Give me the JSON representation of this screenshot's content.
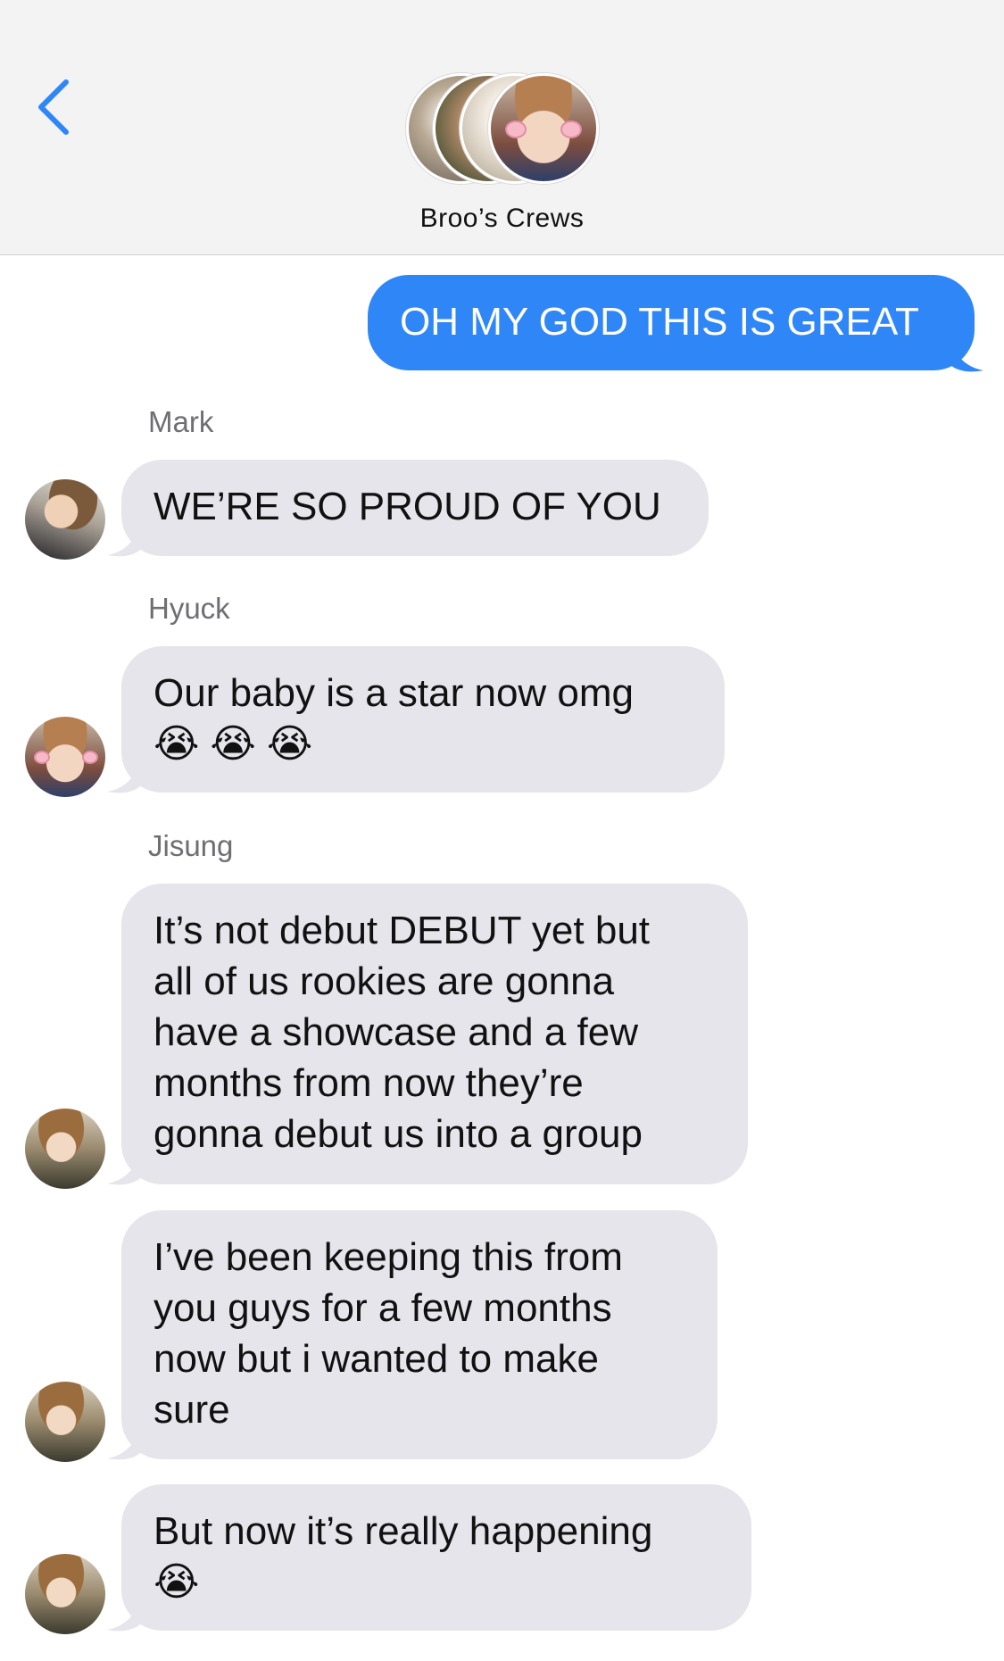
{
  "header": {
    "title": "Broo’s Crews"
  },
  "messages": {
    "m1": {
      "text": "OH MY GOD THIS IS GREAT"
    },
    "m2": {
      "sender": "Mark",
      "text": "WE’RE SO PROUD OF YOU"
    },
    "m3": {
      "sender": "Hyuck",
      "line1": "Our baby is a star now omg",
      "emoji": "😭😭😭"
    },
    "m4": {
      "sender": "Jisung",
      "lines": [
        "It’s not debut DEBUT yet but",
        "all of us rookies are gonna",
        "have a showcase and a few",
        "months from now they’re",
        "gonna debut us into a group"
      ]
    },
    "m5": {
      "lines": [
        "I’ve been keeping this from",
        "you guys for a few months",
        "now but i wanted to make",
        "sure"
      ]
    },
    "m6": {
      "line1": "But now it’s really happening",
      "emoji": "😭"
    }
  },
  "colors": {
    "outgoing_bubble": "#2f86f6",
    "incoming_bubble": "#e6e5eb",
    "accent": "#2f86f6"
  },
  "icons": {
    "back": "chevron-left-icon"
  }
}
